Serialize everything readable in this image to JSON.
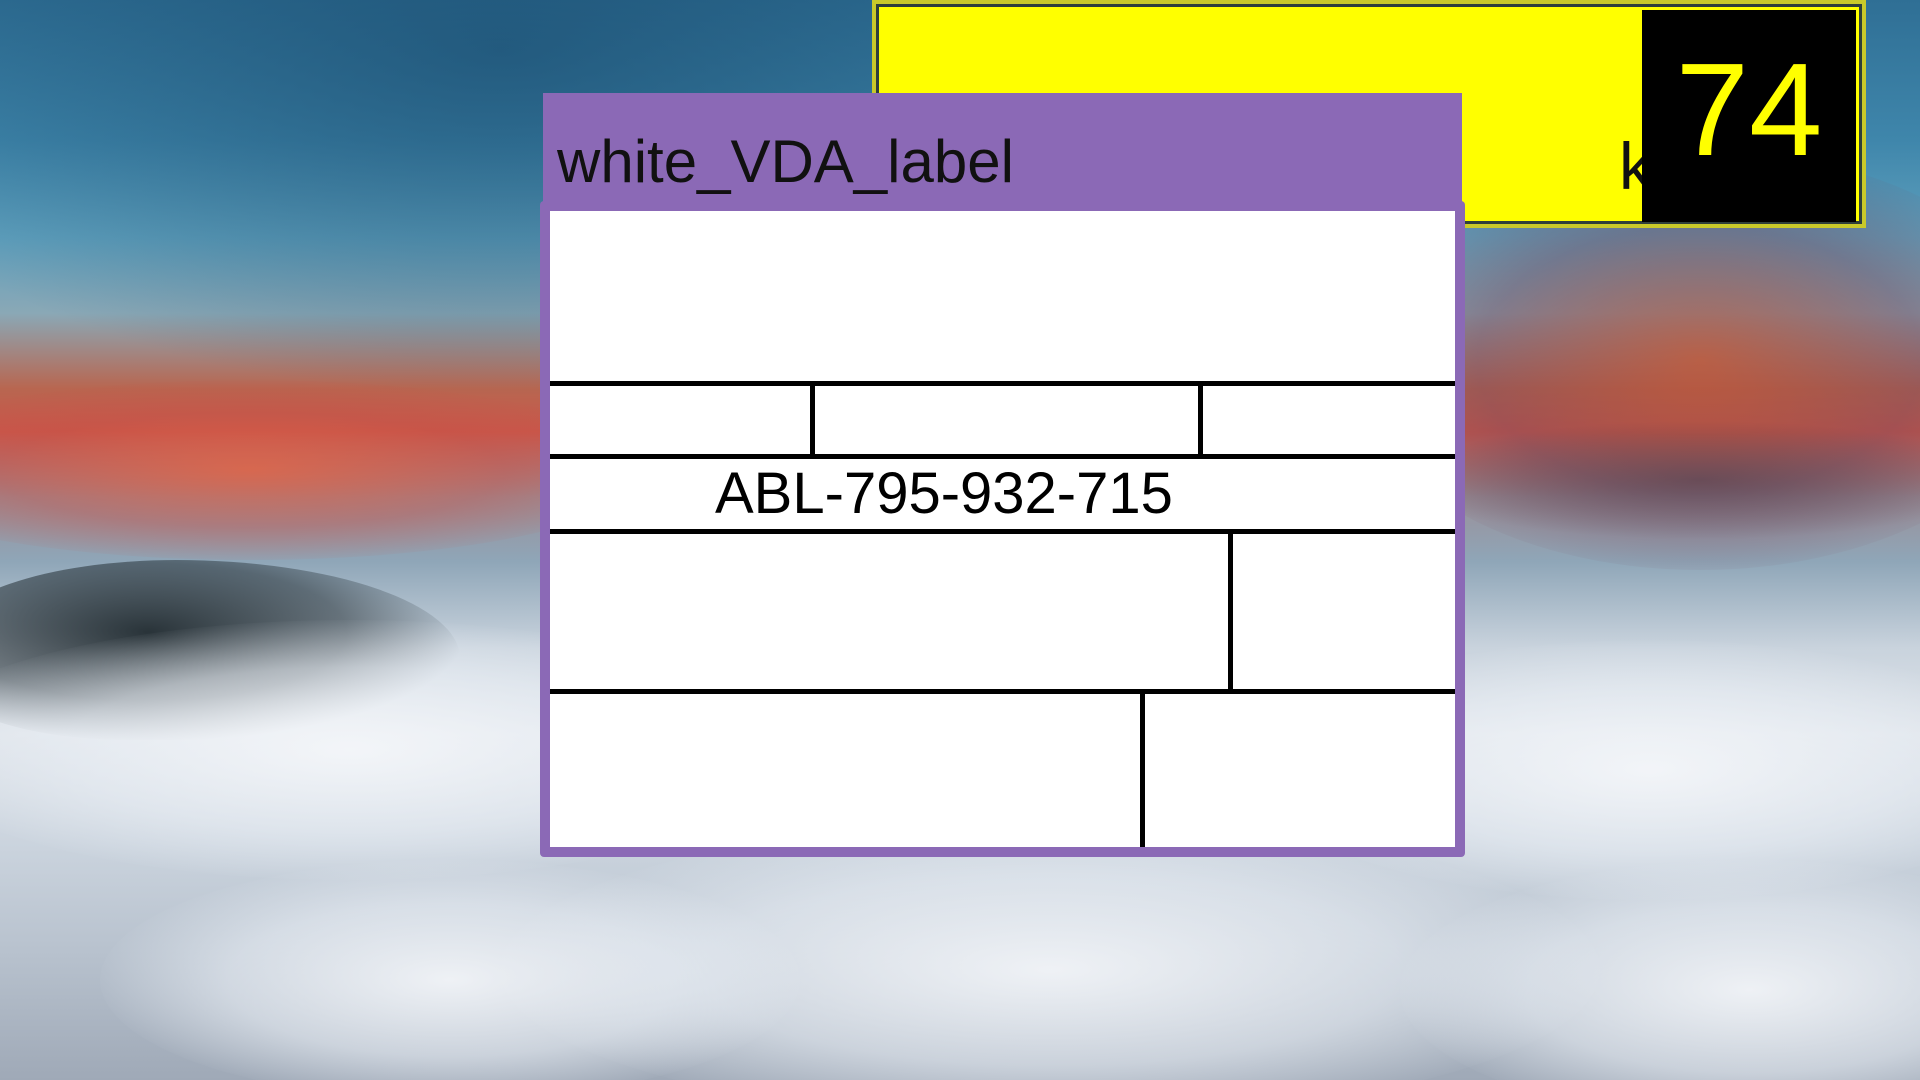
{
  "desktop": {
    "background": "sky-above-clouds-wallpaper"
  },
  "counter_window": {
    "title_partial": "k",
    "count": "74",
    "background_color": "#ffff00",
    "badge_color": "#000000"
  },
  "label_window": {
    "title": "white_VDA_label",
    "titlebar_color": "#8b69b6",
    "code": "ABL-795-932-715"
  }
}
